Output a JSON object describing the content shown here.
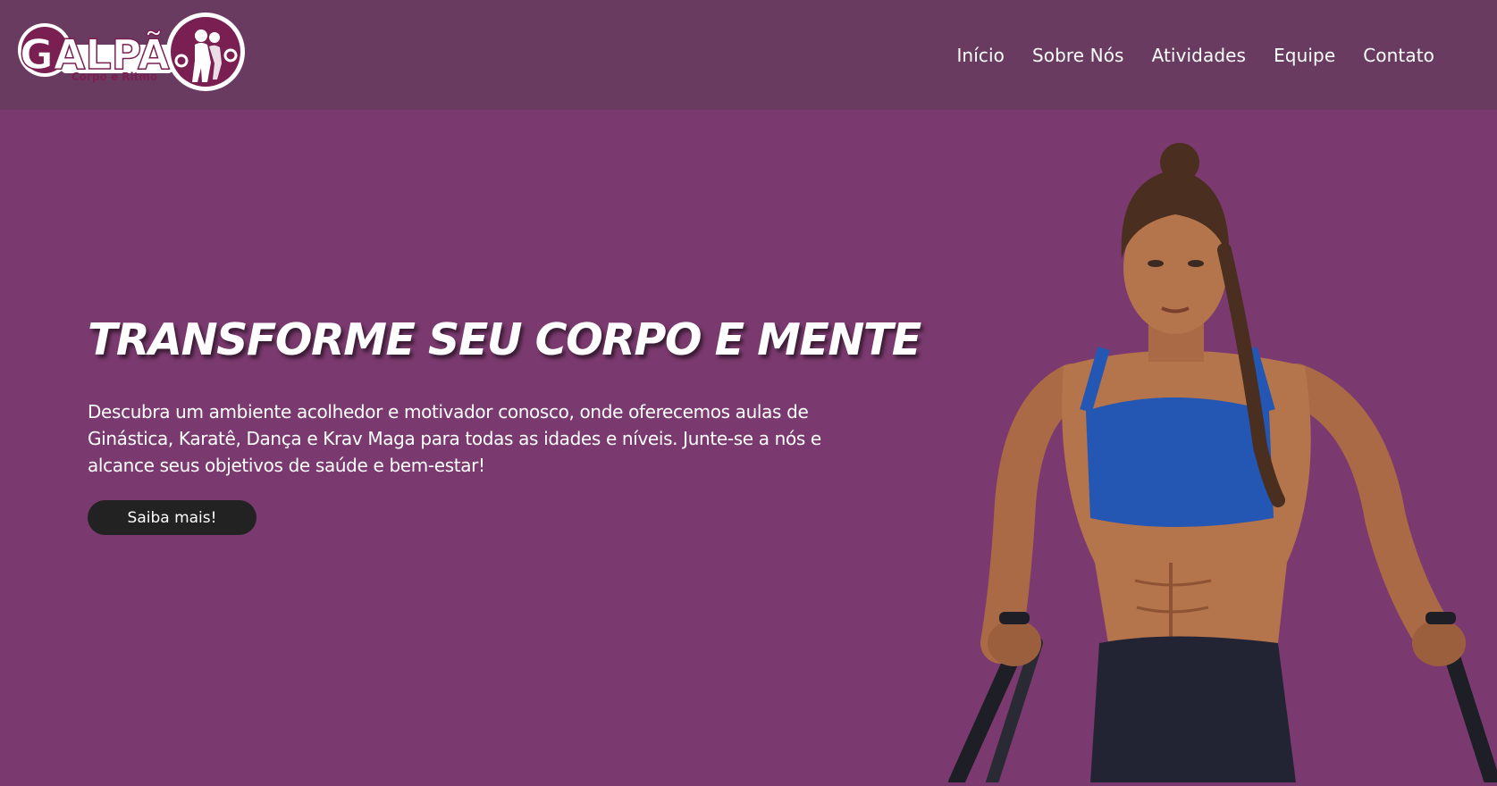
{
  "logo": {
    "title": "GALPÃO",
    "subtitle": "Corpo e Ritmo"
  },
  "nav": {
    "items": [
      "Início",
      "Sobre Nós",
      "Atividades",
      "Equipe",
      "Contato"
    ]
  },
  "hero": {
    "title": "TRANSFORME SEU CORPO E MENTE",
    "description": "Descubra um ambiente acolhedor e motivador conosco, onde oferecemos aulas de Ginástica, Karatê, Dança e Krav Maga para todas as idades e níveis. Junte-se a nós e alcance seus objetivos de saúde e bem-estar!",
    "button": "Saiba mais!"
  },
  "colors": {
    "navbar": "#6a3b61",
    "background": "#7b3a6f",
    "logo_accent": "#7a1f52",
    "button": "#222222"
  },
  "icons": [
    "logo-emblem-icon",
    "athlete-photo"
  ]
}
